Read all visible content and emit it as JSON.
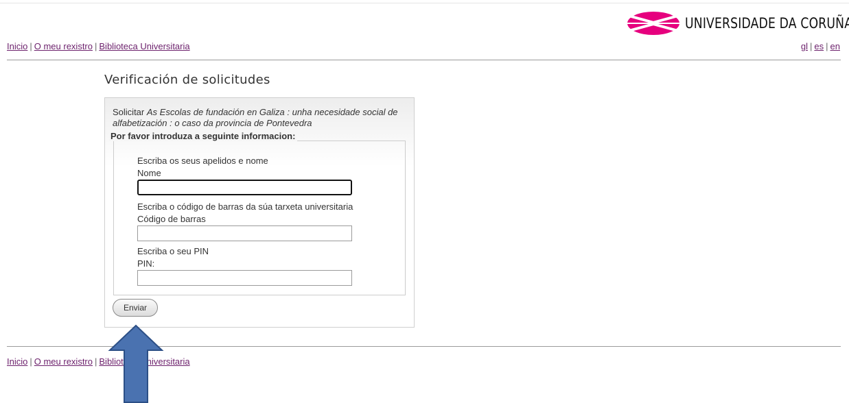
{
  "header": {
    "logo_text": "UNIVERSIDADE DA CORUÑA",
    "logo_icon": "udc-logo-icon",
    "brand_color": "#e6007e"
  },
  "nav": {
    "inicio": "Inicio",
    "rexistro": "O meu rexistro",
    "biblioteca": "Biblioteca Universitaria",
    "separator": "|"
  },
  "languages": {
    "gl": "gl",
    "es": "es",
    "en": "en"
  },
  "page_title": "Verificación de solicitudes",
  "form": {
    "solicit_prefix": "Solicitar ",
    "book_title": "As Escolas de fundación en Galiza : unha necesidade social de alfabetización : o caso da provincia de Pontevedra",
    "legend": "Por favor introduza a seguinte informacion:",
    "nome": {
      "instruction": "Escriba os seus apelidos e nome",
      "label": "Nome",
      "value": ""
    },
    "barcode": {
      "instruction": "Escriba o código de barras da súa tarxeta universitaria",
      "label": "Código de barras",
      "value": ""
    },
    "pin": {
      "instruction": "Escriba o seu PIN",
      "label": "PIN:",
      "value": ""
    },
    "submit_label": "Enviar"
  },
  "annotation": {
    "arrow_color": "#4a72b0",
    "arrow_border": "#2c4f86",
    "direction": "up"
  },
  "colors": {
    "link": "#6b1f6b",
    "text": "#333333"
  }
}
